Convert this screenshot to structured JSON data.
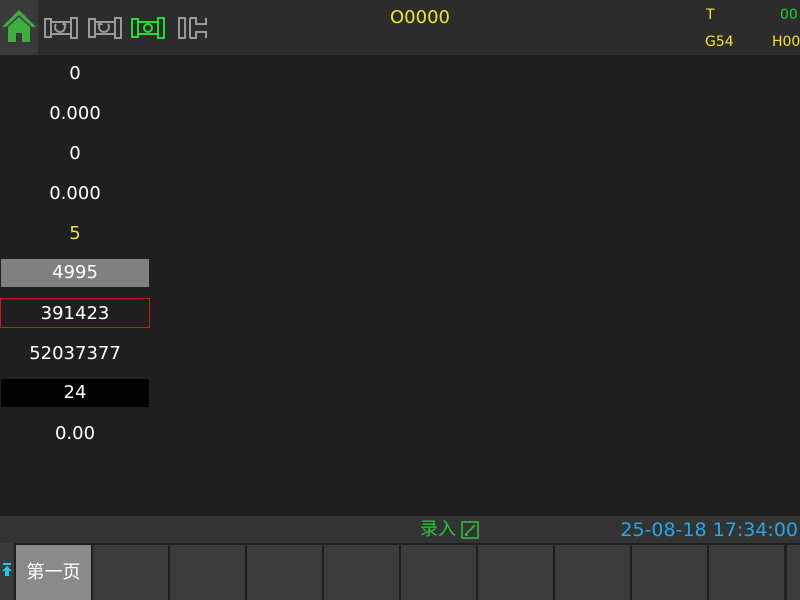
{
  "header": {
    "program_number": "O0000",
    "tool_label": "T",
    "tool_value": "00",
    "coord_system": "G54",
    "h_offset": "H00",
    "icons": [
      "home-icon",
      "spindle-cw-icon",
      "spindle-ccw-icon",
      "spindle-active-icon",
      "chuck-icon"
    ]
  },
  "values": [
    {
      "text": "0",
      "style": "normal"
    },
    {
      "text": "0.000",
      "style": "normal"
    },
    {
      "text": "0",
      "style": "normal"
    },
    {
      "text": "0.000",
      "style": "normal"
    },
    {
      "text": "5",
      "style": "yellow"
    },
    {
      "text": "4995",
      "style": "grey-highlight"
    },
    {
      "text": "391423",
      "style": "red-border"
    },
    {
      "text": "52037377",
      "style": "normal"
    },
    {
      "text": "24",
      "style": "black-background"
    },
    {
      "text": "0.00",
      "style": "normal"
    }
  ],
  "statusbar": {
    "mode": "录入",
    "mode_icon": "edit-icon",
    "datetime": "25-08-18 17:34:00"
  },
  "softkeys": {
    "first_label": "第一页",
    "left_arrow_icon": "upload-arrow-icon"
  },
  "colors": {
    "background": "#1f1f1f",
    "bar": "#2c2c2c",
    "yellow": "#f2e230",
    "green": "#22cc33",
    "blue": "#22a8e8",
    "red": "#d01818"
  }
}
